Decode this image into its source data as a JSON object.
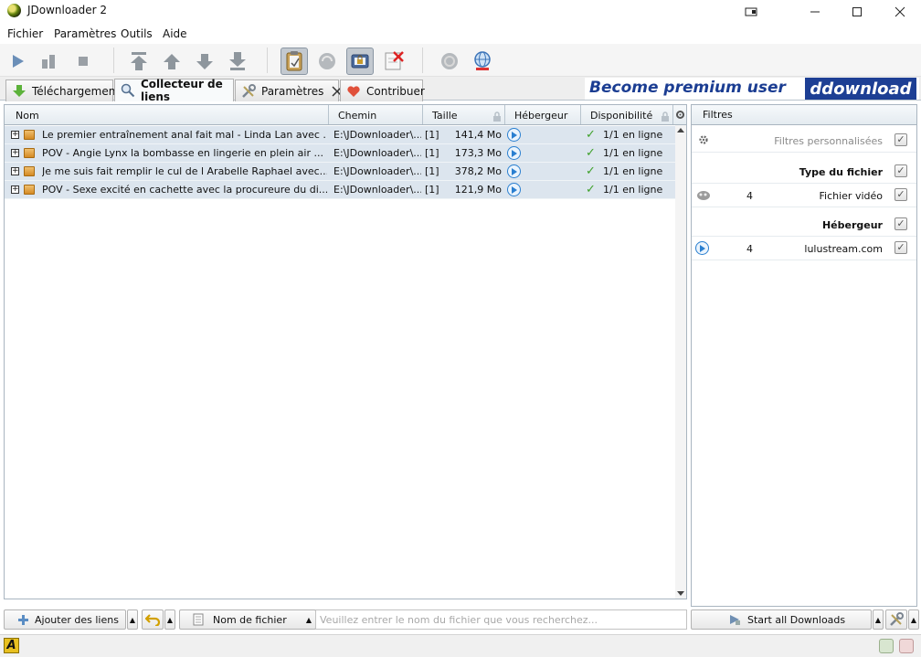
{
  "window": {
    "title": "JDownloader 2"
  },
  "menu": {
    "items": [
      "Fichier",
      "Paramètres",
      "Outils",
      "Aide"
    ]
  },
  "tabs": [
    {
      "label": "Téléchargement",
      "icon": "download-arrow-icon"
    },
    {
      "label": "Collecteur de liens",
      "icon": "magnifier-icon"
    },
    {
      "label": "Paramètres",
      "icon": "wrench-icon"
    },
    {
      "label": "Contribuer",
      "icon": "heart-icon"
    }
  ],
  "banner": {
    "text": "Become premium user",
    "logo": "ddownload"
  },
  "table": {
    "columns": [
      "Nom",
      "Chemin",
      "Taille",
      "Hébergeur",
      "Disponibilité"
    ],
    "rows": [
      {
        "name": "Le premier entraînement anal fait mal - Linda Lan avec ...",
        "path": "E:\\JDownloader\\...",
        "count": "[1]",
        "size": "141,4 Mo",
        "availability": "1/1 en ligne"
      },
      {
        "name": "POV - Angie Lynx la bombasse en lingerie en plein air ...",
        "path": "E:\\JDownloader\\...",
        "count": "[1]",
        "size": "173,3 Mo",
        "availability": "1/1 en ligne"
      },
      {
        "name": "Je me suis fait remplir le cul de l Arabelle Raphael avec...",
        "path": "E:\\JDownloader\\...",
        "count": "[1]",
        "size": "378,2 Mo",
        "availability": "1/1 en ligne"
      },
      {
        "name": "POV - Sexe excité en cachette avec la procureure du di...",
        "path": "E:\\JDownloader\\...",
        "count": "[1]",
        "size": "121,9 Mo",
        "availability": "1/1 en ligne"
      }
    ]
  },
  "filters": {
    "header": "Filtres",
    "custom": "Filtres personnalisées",
    "file_type_header": "Type du fichier",
    "file_type_count": "4",
    "file_type_label": "Fichier vidéo",
    "hoster_header": "Hébergeur",
    "hoster_count": "4",
    "hoster_label": "lulustream.com"
  },
  "bottom": {
    "add_links": "Ajouter des liens",
    "search_mode": "Nom de fichier",
    "search_placeholder": "Veuillez entrer le nom du fichier que vous recherchez...",
    "start_all": "Start all Downloads"
  },
  "colors": {
    "row_bg": "#dce5ee",
    "accent_blue": "#1d3f94",
    "online_green": "#3fa12b"
  }
}
